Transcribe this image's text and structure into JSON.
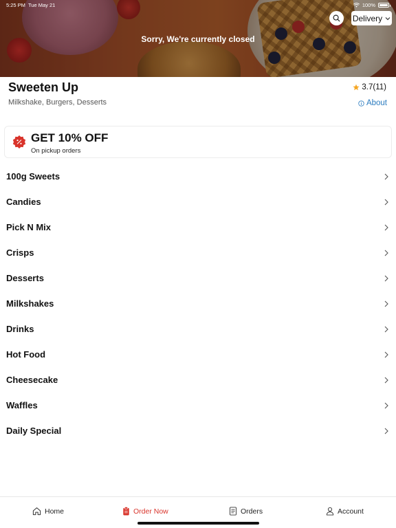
{
  "status_bar": {
    "time": "5:25 PM",
    "date": "Tue May 21",
    "battery": "100%"
  },
  "header": {
    "closed_message": "Sorry, We're currently closed",
    "delivery_mode": "Delivery"
  },
  "store": {
    "name": "Sweeten Up",
    "categories": "Milkshake, Burgers, Desserts",
    "rating": "3.7(11)",
    "about_label": "About"
  },
  "offer": {
    "title": "GET 10% OFF",
    "subtitle": "On pickup orders",
    "badge_color": "#d9342b"
  },
  "menu_categories": [
    "100g Sweets",
    "Candies",
    "Pick N Mix",
    "Crisps",
    "Desserts",
    "Milkshakes",
    "Drinks",
    "Hot Food",
    "Cheesecake",
    "Waffles",
    "Daily Special"
  ],
  "tabs": [
    {
      "label": "Home",
      "icon": "home-icon"
    },
    {
      "label": "Order Now",
      "icon": "order-icon",
      "active": true
    },
    {
      "label": "Orders",
      "icon": "receipt-icon"
    },
    {
      "label": "Account",
      "icon": "person-icon"
    }
  ],
  "colors": {
    "accent": "#d9342b",
    "link": "#2a7bbf",
    "star": "#f5a623"
  }
}
